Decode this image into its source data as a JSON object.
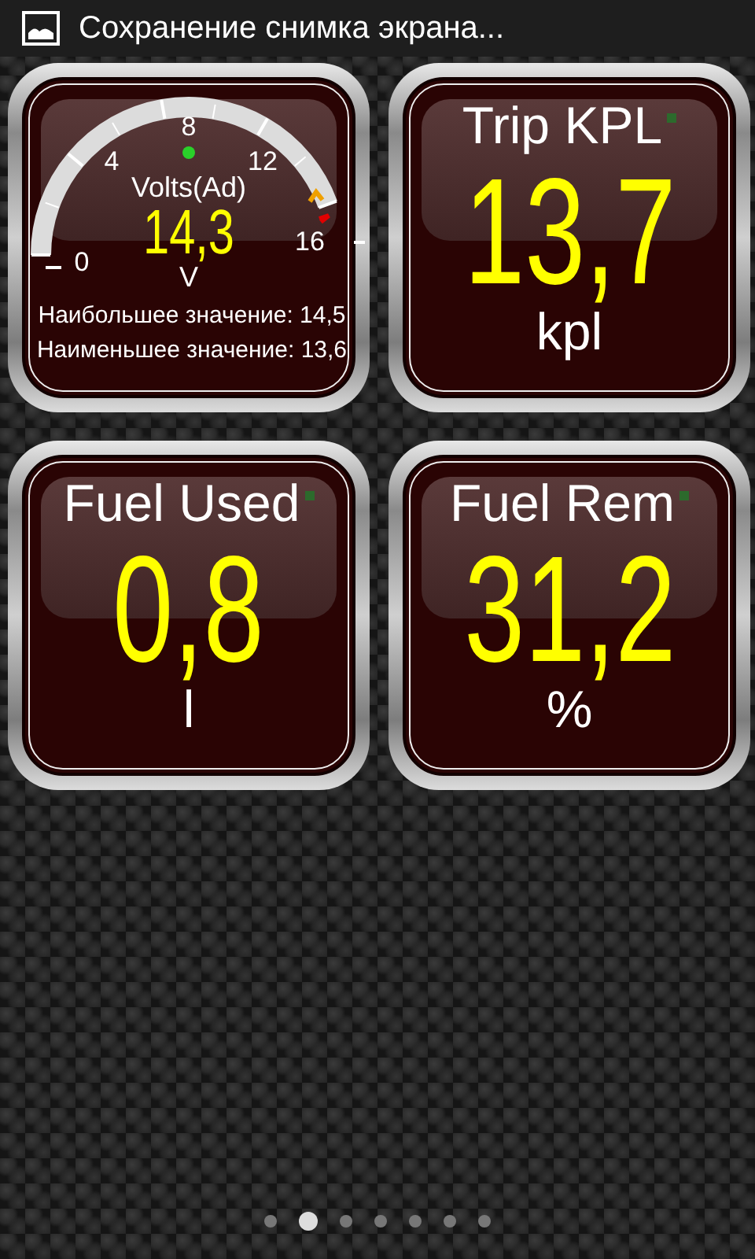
{
  "status_bar": {
    "notification": "Сохранение снимка экрана..."
  },
  "gauges": [
    {
      "kind": "dial",
      "label": "Volts(Ad)",
      "value": "14,3",
      "unit": "V",
      "ticks": [
        "0",
        "4",
        "8",
        "12",
        "16"
      ],
      "max_line": "Наибольшее значение: 14,5",
      "min_line": "Наименьшее значение: 13,6"
    },
    {
      "kind": "digital",
      "label": "Trip KPL",
      "value": "13,7",
      "unit": "kpl"
    },
    {
      "kind": "digital",
      "label": "Fuel Used",
      "value": "0,8",
      "unit": "l"
    },
    {
      "kind": "digital",
      "label": "Fuel Rem",
      "value": "31,2",
      "unit": "%"
    }
  ],
  "pages": [
    {
      "selected": false
    },
    {
      "selected": true
    },
    {
      "selected": false
    },
    {
      "selected": false
    },
    {
      "selected": false
    },
    {
      "selected": false
    },
    {
      "selected": false
    }
  ]
}
